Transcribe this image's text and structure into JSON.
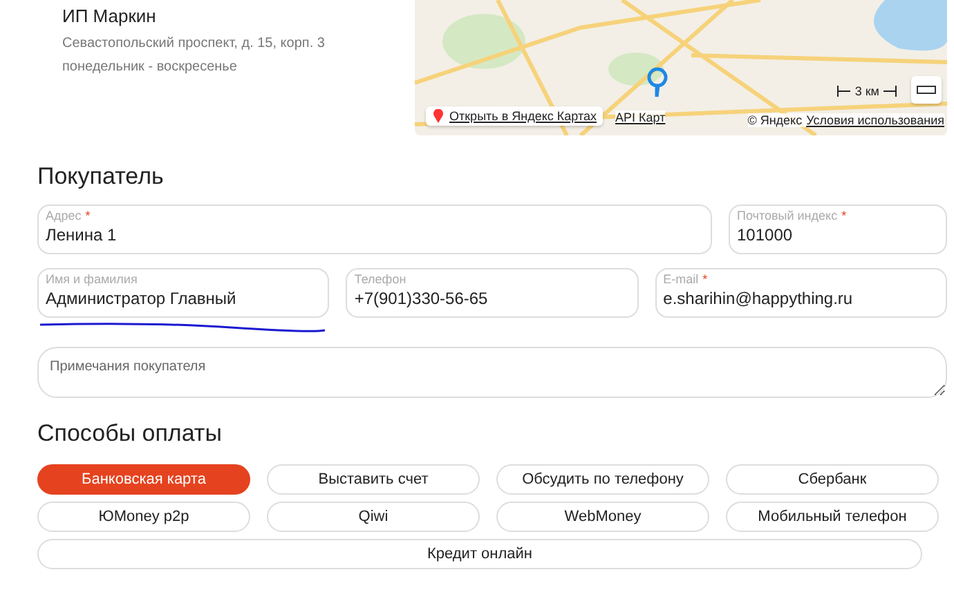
{
  "pickup_point": {
    "name": "ИП Маркин",
    "address": "Севастопольский проспект, д. 15, корп. 3 понедельник - воскресенье"
  },
  "map": {
    "open_link": "Открыть в Яндекс Картах",
    "api_link": "API Карт",
    "scale": "3 км",
    "copyright": "© Яндекс",
    "terms_link": "Условия использования"
  },
  "buyer": {
    "title": "Покупатель",
    "fields": [
      {
        "label": "Адрес",
        "required_mark": "*",
        "value": "Ленина 1",
        "kind": "input"
      },
      {
        "label": "Почтовый индекс",
        "required_mark": "*",
        "value": "101000",
        "kind": "input"
      },
      {
        "label": "Имя и фамилия",
        "value": "Администратор Главный",
        "kind": "input"
      },
      {
        "label": "Телефон",
        "value": "+7(901)330-56-65",
        "kind": "input"
      },
      {
        "label": "E-mail",
        "required_mark": "*",
        "value": "e.sharihin@happything.ru",
        "kind": "input"
      },
      {
        "placeholder": "Примечания покупателя",
        "kind": "textarea"
      }
    ]
  },
  "payment": {
    "title": "Способы оплаты",
    "methods": [
      {
        "label": "Банковская карта",
        "selected": true
      },
      {
        "label": "Выставить счет",
        "selected": false
      },
      {
        "label": "Обсудить по телефону",
        "selected": false
      },
      {
        "label": "Сбербанк",
        "selected": false
      },
      {
        "label": "ЮMoney p2p",
        "selected": false
      },
      {
        "label": "Qiwi",
        "selected": false
      },
      {
        "label": "WebMoney",
        "selected": false
      },
      {
        "label": "Мобильный телефон",
        "selected": false
      },
      {
        "label": "Кредит онлайн",
        "selected": false
      }
    ]
  }
}
